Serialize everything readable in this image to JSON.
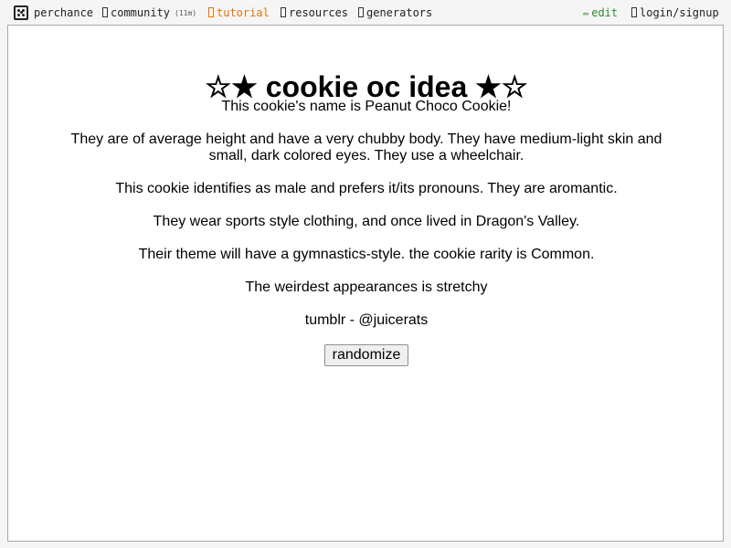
{
  "nav": {
    "brand": "perchance",
    "community": "community",
    "community_badge": "(11m)",
    "tutorial": "tutorial",
    "resources": "resources",
    "generators": "generators",
    "edit_icon": "✏",
    "edit": "edit",
    "login": "login/signup"
  },
  "colors": {
    "tutorial": "#e67300",
    "edit": "#2e8b2e"
  },
  "main": {
    "title": "☆★ cookie oc idea ★☆",
    "paragraphs": [
      "This cookie's name is Peanut Choco Cookie!",
      "They are of average height and have a very chubby body. They have medium-light skin and small, dark colored eyes. They use a wheelchair.",
      "This cookie identifies as male and prefers it/its pronouns. They are aromantic.",
      "They wear sports style clothing, and once lived in Dragon's Valley.",
      "Their theme will have a gymnastics-style. the cookie rarity is Common.",
      "The weirdest appearances is stretchy",
      "tumblr - @juicerats"
    ],
    "randomize_label": "randomize"
  }
}
